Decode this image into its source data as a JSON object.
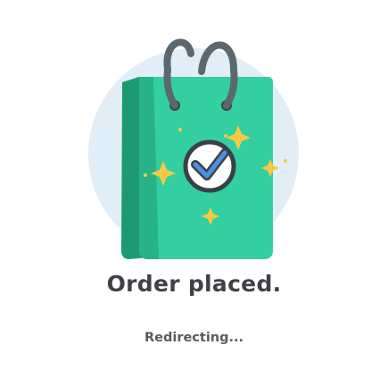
{
  "confirmation": {
    "title": "Order placed.",
    "status_text": "Redirecting..."
  },
  "illustration": {
    "icon": "shopping-bag-check-icon",
    "colors": {
      "circle": "#e1eef8",
      "bag_front": "#34cfa0",
      "bag_side": "#1e9a72",
      "bag_front_dark": "#27b387",
      "handle": "#5c6870",
      "sparkle": "#f7c844",
      "check_circle_bg": "#ffffff",
      "check_ring": "#3a4048",
      "check_mark": "#4a90e2"
    }
  }
}
